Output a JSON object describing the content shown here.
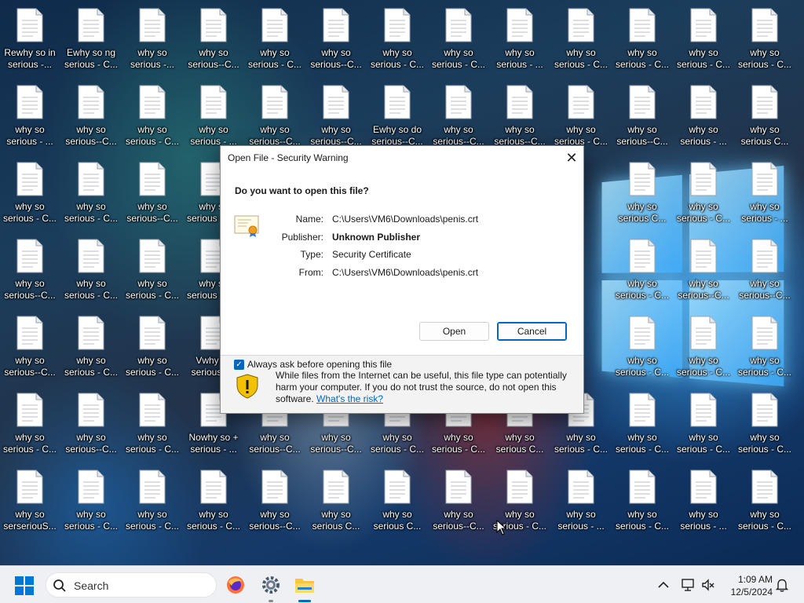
{
  "desktop": {
    "icons": [
      {
        "label": "Rewhy so in\nserious -..."
      },
      {
        "label": "Ewhy so ng\nserious - C..."
      },
      {
        "label": "why so\nserious -..."
      },
      {
        "label": "why so\nserious--C..."
      },
      {
        "label": "why so\nserious - C..."
      },
      {
        "label": "why so\nserious--C..."
      },
      {
        "label": "why so\nserious - C..."
      },
      {
        "label": "why so\nserious - C..."
      },
      {
        "label": "why so\nserious - ..."
      },
      {
        "label": "why so\nserious - C..."
      },
      {
        "label": "why so\nserious - C..."
      },
      {
        "label": "why so\nserious - C..."
      },
      {
        "label": "why so\nserious - C..."
      },
      {
        "label": "why so\nserious - ..."
      },
      {
        "label": "why so\nserious--C..."
      },
      {
        "label": "why so\nserious - C..."
      },
      {
        "label": "why so\nserious - ..."
      },
      {
        "label": "why so\nserious--C..."
      },
      {
        "label": "why so\nserious--C..."
      },
      {
        "label": "Ewhy so do\nserious--C..."
      },
      {
        "label": "why so\nserious--C..."
      },
      {
        "label": "why so\nserious--C..."
      },
      {
        "label": "why so\nserious - C..."
      },
      {
        "label": "why so\nserious--C..."
      },
      {
        "label": "why so\nserious - ..."
      },
      {
        "label": "why so\nserious C..."
      },
      {
        "label": "why so\nserious - C..."
      },
      {
        "label": "why so\nserious - C..."
      },
      {
        "label": "why so\nserious--C..."
      },
      {
        "label": "why so\nserious - C..."
      },
      {
        "label": "why so\nserious C..."
      },
      {
        "label": "why so\nserious - C..."
      },
      {
        "label": "why so\nserious - ..."
      },
      {
        "label": "why so\nserious--C..."
      },
      {
        "label": "why so\nserious - C..."
      },
      {
        "label": "why so\nserious - C..."
      },
      {
        "label": "why so\nserious - C..."
      },
      {
        "label": "why so\nserious - C..."
      },
      {
        "label": "why so\nserious--C..."
      },
      {
        "label": "why so\nserious--C..."
      },
      {
        "label": "why so\nserious--C..."
      },
      {
        "label": "why so\nserious - C..."
      },
      {
        "label": "why so\nserious - C..."
      },
      {
        "label": "Vwhy so\nserious--..."
      },
      {
        "label": "why so\nserious - C..."
      },
      {
        "label": "why so\nserious - C..."
      },
      {
        "label": "why so\nserious - C..."
      },
      {
        "label": "why so\nserious - C..."
      },
      {
        "label": "why so\nserious--C..."
      },
      {
        "label": "why so\nserious - C..."
      },
      {
        "label": "Nowhy so +\nserious - ..."
      },
      {
        "label": "why so\nserious--C..."
      },
      {
        "label": "why so\nserious--C..."
      },
      {
        "label": "why so\nserious - C..."
      },
      {
        "label": "why so\nserious - C..."
      },
      {
        "label": "why so\nserious C..."
      },
      {
        "label": "why so\nserious - C..."
      },
      {
        "label": "why so\nserious - C..."
      },
      {
        "label": "why so\nserious - C..."
      },
      {
        "label": "why so\nserious - C..."
      },
      {
        "label": "why so\nserseriouS..."
      },
      {
        "label": "why so\nserious - C..."
      },
      {
        "label": "why so\nserious - C..."
      },
      {
        "label": "why so\nserious - C..."
      },
      {
        "label": "why so\nserious--C..."
      },
      {
        "label": "why so\nserious C..."
      },
      {
        "label": "why so\nserious C..."
      },
      {
        "label": "why so\nserious--C..."
      },
      {
        "label": "why so\nserious - C..."
      },
      {
        "label": "why so\nserious - ..."
      },
      {
        "label": "why so\nserious - C..."
      },
      {
        "label": "why so\nserious - ..."
      },
      {
        "label": "why so\nserious - C..."
      },
      {
        "label": "why so\nseriouss-C..."
      }
    ]
  },
  "dialog": {
    "title": "Open File - Security Warning",
    "close_glyph": "✕",
    "question": "Do you want to open this file?",
    "fields": [
      {
        "key": "Name:",
        "value": "C:\\Users\\VM6\\Downloads\\penis.crt"
      },
      {
        "key": "Publisher:",
        "value": "Unknown Publisher"
      },
      {
        "key": "Type:",
        "value": "Security Certificate"
      },
      {
        "key": "From:",
        "value": "C:\\Users\\VM6\\Downloads\\penis.crt"
      }
    ],
    "open_label": "Open",
    "cancel_label": "Cancel",
    "always_ask_label": "Always ask before opening this file",
    "always_ask_checked": true,
    "warning_text": "While files from the Internet can be useful, this file type can potentially harm your computer. If you do not trust the source, do not open this software.",
    "risk_link": "What's the risk?"
  },
  "taskbar": {
    "search_placeholder": "Search",
    "time": "1:09 AM",
    "date": "12/5/2024"
  },
  "colors": {
    "accent": "#0067c0",
    "warning_shield": "#f2c200"
  }
}
